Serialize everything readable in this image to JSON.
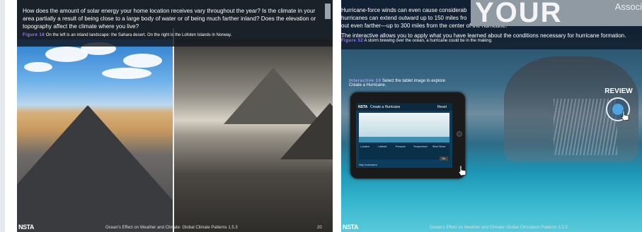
{
  "left_page": {
    "intro": "How does the amount of solar energy your home location receives vary throughout the year? Is the climate in your area partially a result of being close to a large body of water or of being much farther inland? Does the elevation or topography affect the climate where you live?",
    "figure_label": "Figure 16",
    "figure_caption": "On the left is an inland landscape: the Sahara desert. On the right is the Lofoten Islands in Norway.",
    "footer_logo": "NSTA",
    "footer_title": "Ocean's Effect on Weather and Climate: Global Climate Patterns 1.5.3",
    "page_number": "20"
  },
  "right_page": {
    "intro_line1": "Hurricane-force winds can even cause considerab",
    "intro_line2": "hurricanes can extend outward up to 150 miles fro",
    "intro_line3": "out even farther—up to 300 miles from the center of the hurricane.",
    "intro_line4": "The interactive allows you to apply what you have learned about the conditions necessary for hurricane formation.",
    "figure_label": "Figure 52",
    "figure_caption": "A storm brewing over the ocean, a hurricane could be in the making.",
    "interactive_label": "Interactive 10",
    "interactive_caption": "Select the tablet image to explore Create a Hurricane.",
    "tablet": {
      "logo": "NSTA",
      "title": "Create a Hurricane",
      "menu": "Reset",
      "controls": [
        "Location",
        "Latitude",
        "Pressure",
        "Temperature",
        "Wind Shear"
      ],
      "go": "Go",
      "footer": "Help   Instructions"
    },
    "review_label": "REVIEW",
    "photo_overlay_text": "YOUR",
    "photo_overlay_sub": "Associ",
    "footer_logo": "NSTA",
    "footer_title": "Ocean's Effect on Weather and Climate: Global Circulation Patterns 3.3.3"
  }
}
